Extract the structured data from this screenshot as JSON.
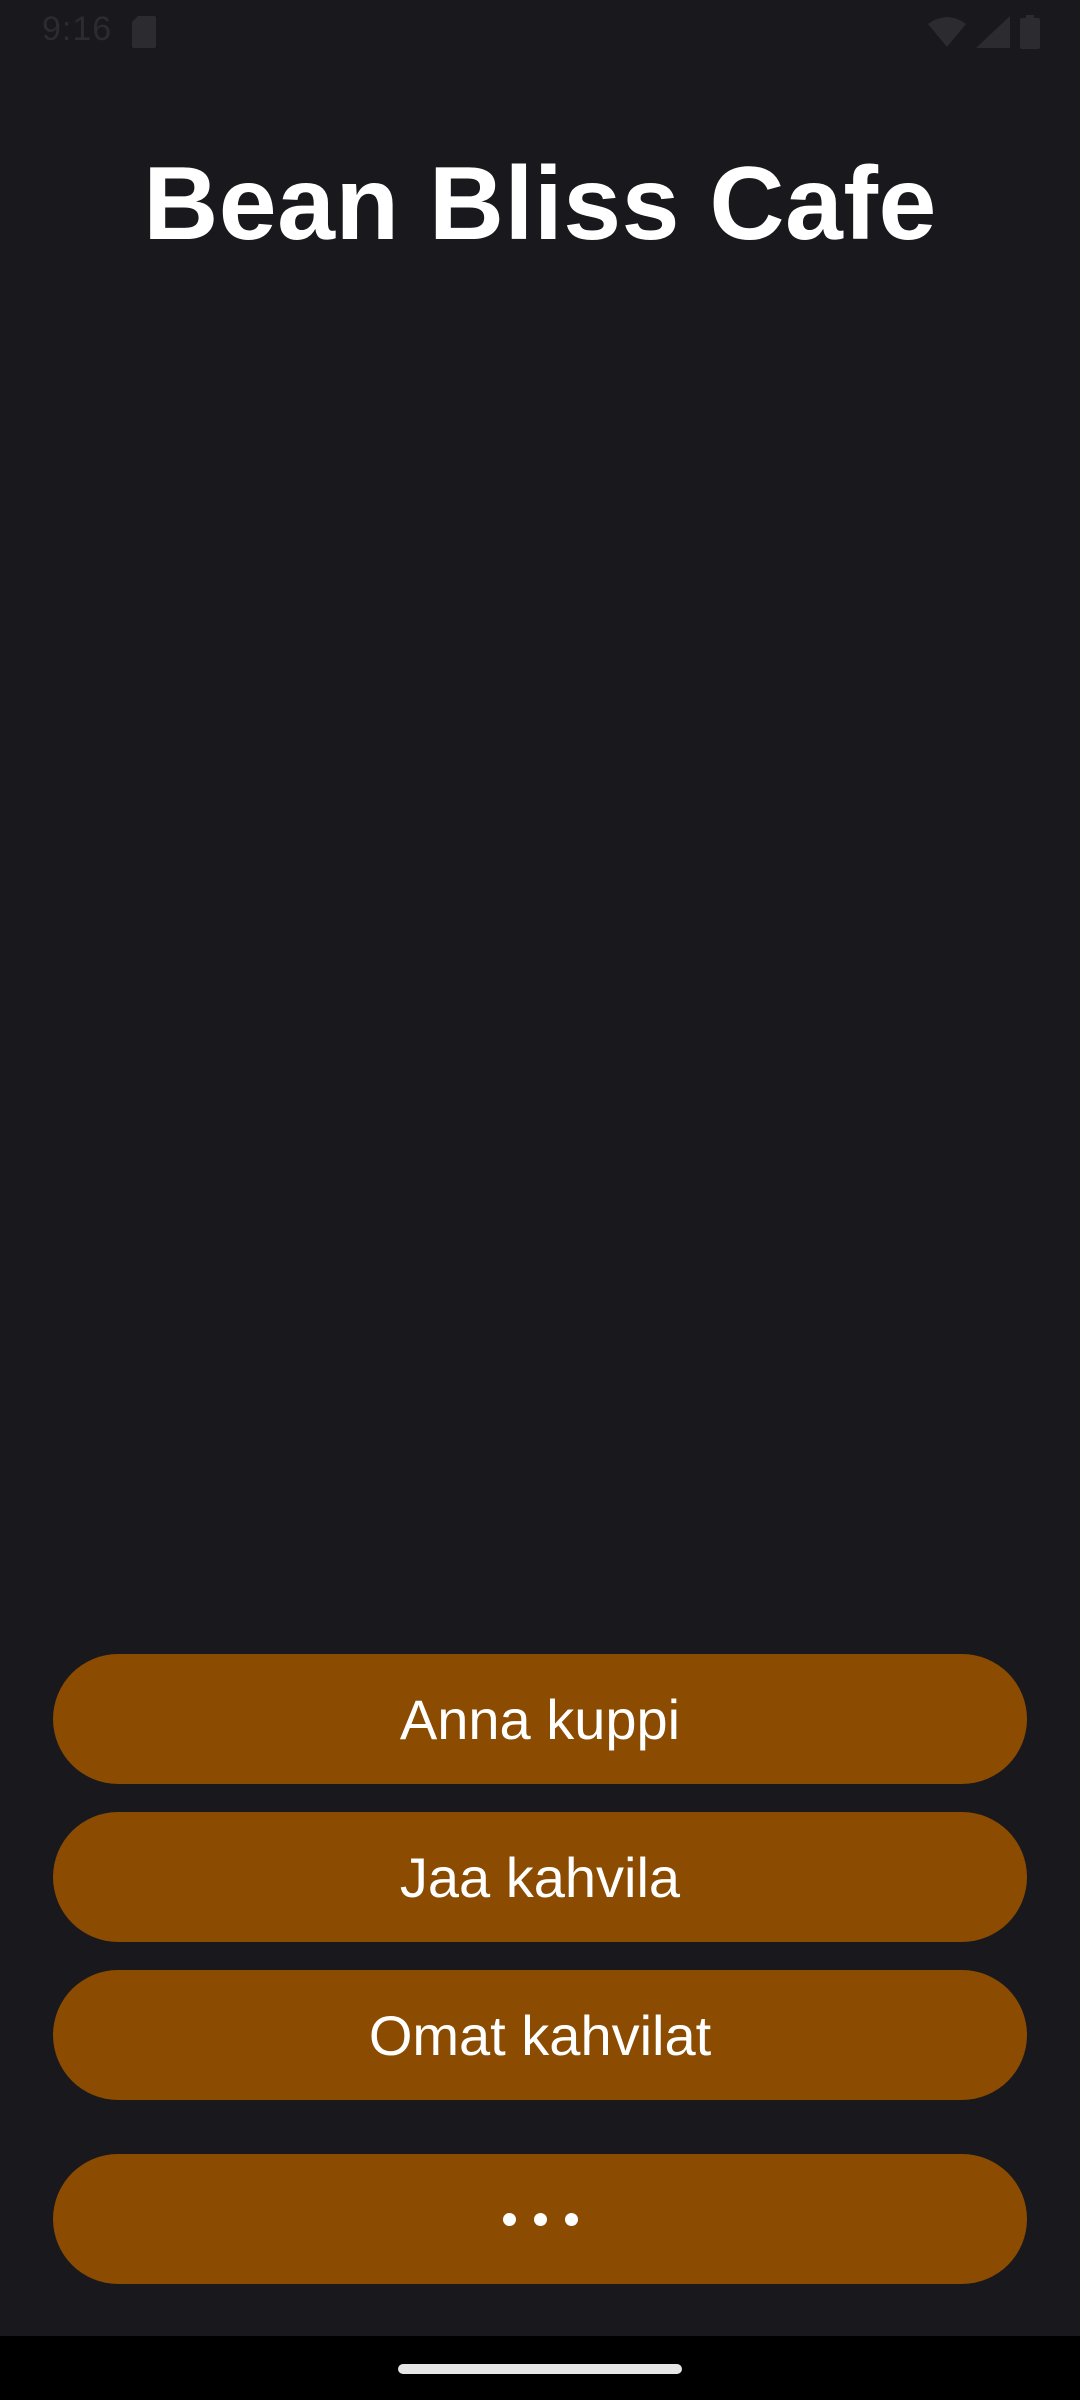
{
  "status_bar": {
    "time": "9:16",
    "icons": [
      "sd-card-icon",
      "wifi-icon",
      "cell-signal-icon",
      "battery-icon"
    ]
  },
  "header": {
    "title": "Bean Bliss Cafe"
  },
  "actions": {
    "give_cup_label": "Anna kuppi",
    "share_cafe_label": "Jaa kahvila",
    "my_cafes_label": "Omat kahvilat",
    "more_icon": "more-horizontal-icon"
  },
  "colors": {
    "background": "#19181d",
    "button": "#8b4b00",
    "button_text": "#ffffff",
    "title_text": "#ffffff"
  }
}
